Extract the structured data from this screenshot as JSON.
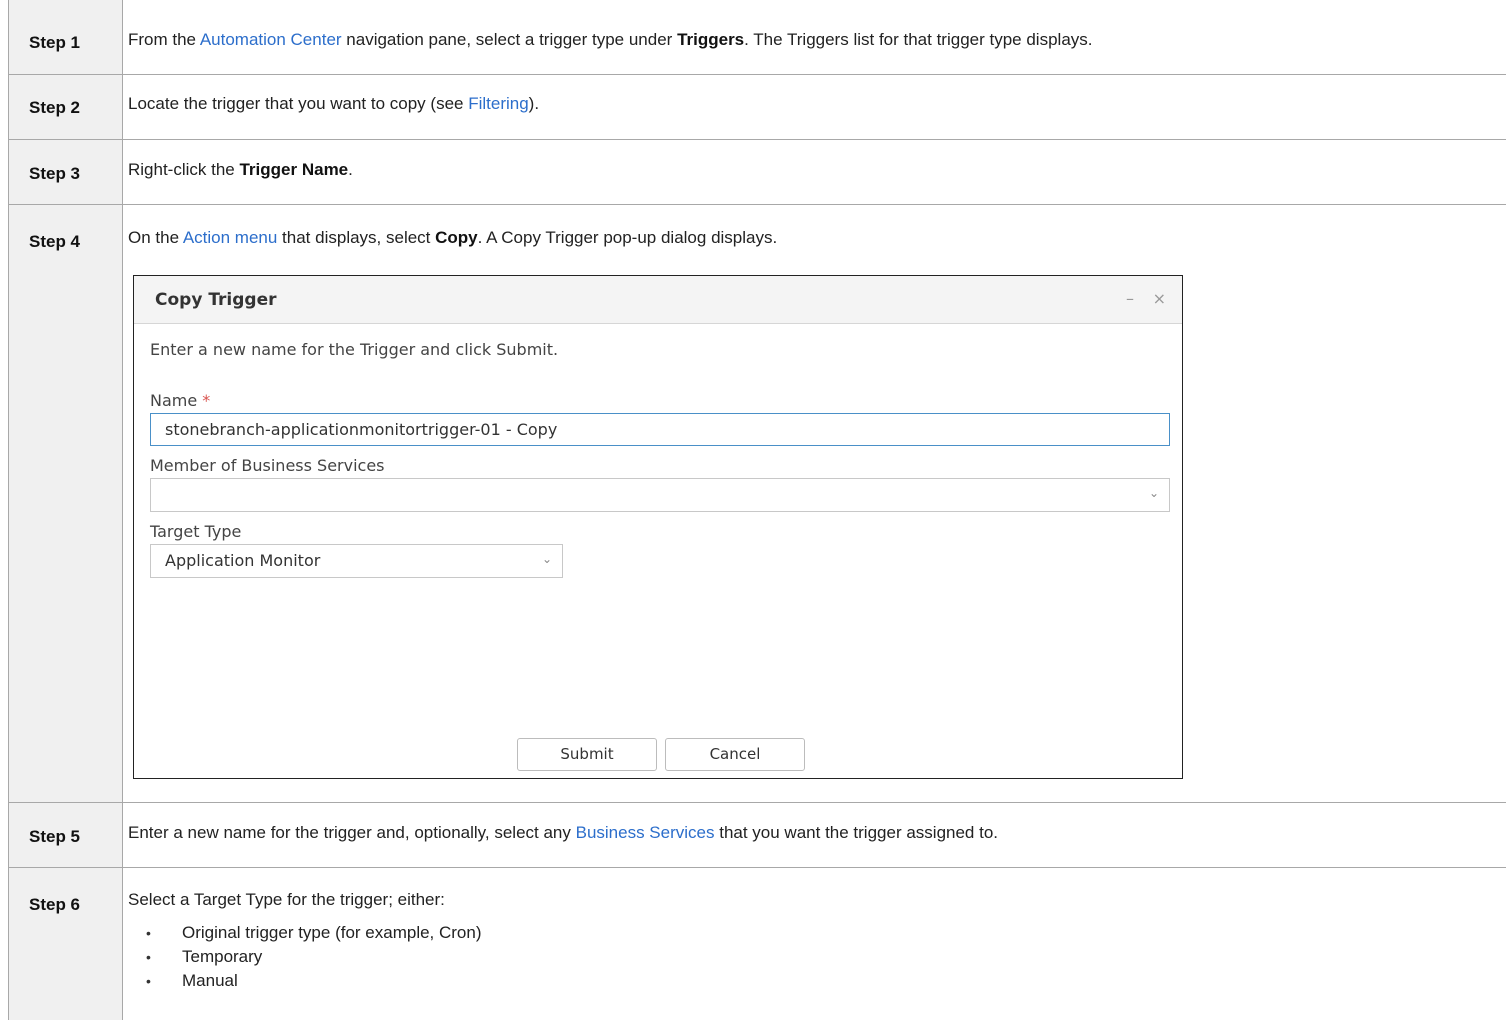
{
  "steps": {
    "s1": {
      "label": "Step 1",
      "t1": "From the ",
      "link1": "Automation Center",
      "t2": " navigation pane, select a trigger type under ",
      "b1": "Triggers",
      "t3": ". The Triggers list for that trigger type displays."
    },
    "s2": {
      "label": "Step 2",
      "t1": "Locate the trigger that you want to copy (see ",
      "link1": "Filtering",
      "t2": ")."
    },
    "s3": {
      "label": "Step 3",
      "t1": "Right-click the ",
      "b1": "Trigger Name",
      "t2": "."
    },
    "s4": {
      "label": "Step 4",
      "t1": "On the ",
      "link1": "Action menu",
      "t2": " that displays, select ",
      "b1": "Copy",
      "t3": ". A Copy Trigger pop-up dialog displays."
    },
    "s5": {
      "label": "Step 5",
      "t1": "Enter a new name for the trigger and, optionally, select any ",
      "link1": "Business Services",
      "t2": " that you want the trigger assigned to."
    },
    "s6": {
      "label": "Step 6",
      "t1": "Select a Target Type for the trigger; either:",
      "bullets": [
        "Original trigger type (for example, Cron)",
        "Temporary",
        "Manual"
      ]
    }
  },
  "dialog": {
    "title": "Copy Trigger",
    "minimize": "–",
    "close": "×",
    "instructions": "Enter a new name for the Trigger and click Submit.",
    "name_label": "Name",
    "required_mark": "*",
    "name_value": "stonebranch-applicationmonitortrigger-01 - Copy",
    "bs_label": "Member of Business Services",
    "bs_value": "",
    "target_label": "Target Type",
    "target_value": "Application Monitor",
    "submit": "Submit",
    "cancel": "Cancel"
  },
  "colors": {
    "link": "#2c6ecb",
    "header_bg": "#f0f0f0",
    "field_focus": "#4a90c8"
  },
  "icons": {
    "dropdown": "chevron-down-icon",
    "minimize": "minimize-icon",
    "close": "close-icon"
  }
}
